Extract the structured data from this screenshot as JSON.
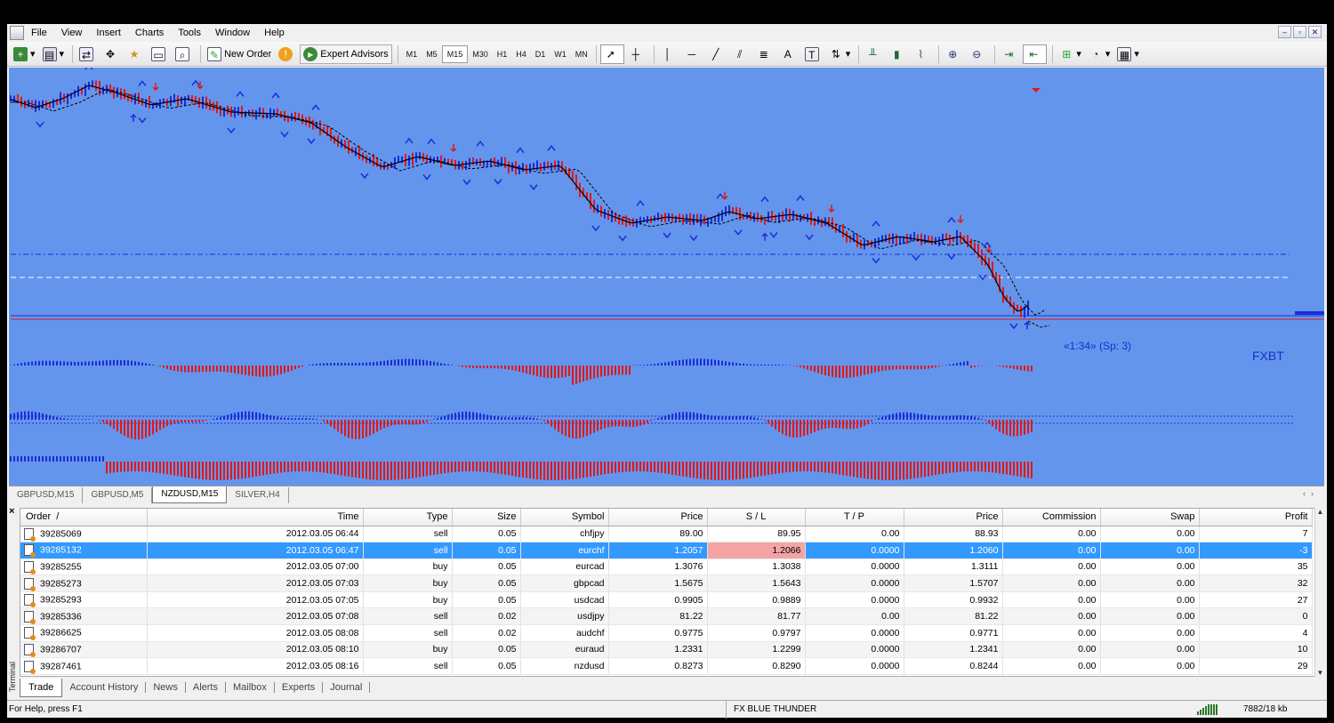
{
  "menu": [
    "File",
    "View",
    "Insert",
    "Charts",
    "Tools",
    "Window",
    "Help"
  ],
  "toolbar": {
    "new_order": "New Order",
    "expert_advisors": "Expert Advisors",
    "timeframes": [
      "M1",
      "M5",
      "M15",
      "M30",
      "H1",
      "H4",
      "D1",
      "W1",
      "MN"
    ],
    "active_timeframe": "M15"
  },
  "chart": {
    "countdown_label": "«1:34» (Sp: 3)",
    "brand": "FXBT",
    "colors": {
      "background": "#6495ed",
      "bull": "#1a2ed8",
      "bear": "#e01818",
      "ma": "#000000"
    }
  },
  "chart_tabs": [
    {
      "label": "GBPUSD,M15",
      "active": false
    },
    {
      "label": "GBPUSD,M5",
      "active": false
    },
    {
      "label": "NZDUSD,M15",
      "active": true
    },
    {
      "label": "SILVER,H4",
      "active": false
    }
  ],
  "terminal": {
    "side_label": "Terminal",
    "columns": [
      "Order",
      "Time",
      "Type",
      "Size",
      "Symbol",
      "Price",
      "S / L",
      "T / P",
      "Price",
      "Commission",
      "Swap",
      "Profit"
    ],
    "rows": [
      {
        "order": "39285069",
        "time": "2012.03.05 06:44",
        "type": "sell",
        "size": "0.05",
        "symbol": "chfjpy",
        "price": "89.00",
        "sl": "89.95",
        "tp": "0.00",
        "cur": "88.93",
        "commission": "0.00",
        "swap": "0.00",
        "profit": "7"
      },
      {
        "order": "39285132",
        "time": "2012.03.05 06:47",
        "type": "sell",
        "size": "0.05",
        "symbol": "eurchf",
        "price": "1.2057",
        "sl": "1.2066",
        "tp": "0.0000",
        "cur": "1.2060",
        "commission": "0.00",
        "swap": "0.00",
        "profit": "-3"
      },
      {
        "order": "39285255",
        "time": "2012.03.05 07:00",
        "type": "buy",
        "size": "0.05",
        "symbol": "eurcad",
        "price": "1.3076",
        "sl": "1.3038",
        "tp": "0.0000",
        "cur": "1.3111",
        "commission": "0.00",
        "swap": "0.00",
        "profit": "35"
      },
      {
        "order": "39285273",
        "time": "2012.03.05 07:03",
        "type": "buy",
        "size": "0.05",
        "symbol": "gbpcad",
        "price": "1.5675",
        "sl": "1.5643",
        "tp": "0.0000",
        "cur": "1.5707",
        "commission": "0.00",
        "swap": "0.00",
        "profit": "32"
      },
      {
        "order": "39285293",
        "time": "2012.03.05 07:05",
        "type": "buy",
        "size": "0.05",
        "symbol": "usdcad",
        "price": "0.9905",
        "sl": "0.9889",
        "tp": "0.0000",
        "cur": "0.9932",
        "commission": "0.00",
        "swap": "0.00",
        "profit": "27"
      },
      {
        "order": "39285336",
        "time": "2012.03.05 07:08",
        "type": "sell",
        "size": "0.02",
        "symbol": "usdjpy",
        "price": "81.22",
        "sl": "81.77",
        "tp": "0.00",
        "cur": "81.22",
        "commission": "0.00",
        "swap": "0.00",
        "profit": "0"
      },
      {
        "order": "39286625",
        "time": "2012.03.05 08:08",
        "type": "sell",
        "size": "0.02",
        "symbol": "audchf",
        "price": "0.9775",
        "sl": "0.9797",
        "tp": "0.0000",
        "cur": "0.9771",
        "commission": "0.00",
        "swap": "0.00",
        "profit": "4"
      },
      {
        "order": "39286707",
        "time": "2012.03.05 08:10",
        "type": "buy",
        "size": "0.05",
        "symbol": "euraud",
        "price": "1.2331",
        "sl": "1.2299",
        "tp": "0.0000",
        "cur": "1.2341",
        "commission": "0.00",
        "swap": "0.00",
        "profit": "10"
      },
      {
        "order": "39287461",
        "time": "2012.03.05 08:16",
        "type": "sell",
        "size": "0.05",
        "symbol": "nzdusd",
        "price": "0.8273",
        "sl": "0.8290",
        "tp": "0.0000",
        "cur": "0.8244",
        "commission": "0.00",
        "swap": "0.00",
        "profit": "29"
      }
    ],
    "selected_row": 1,
    "tabs": [
      "Trade",
      "Account History",
      "News",
      "Alerts",
      "Mailbox",
      "Experts",
      "Journal"
    ],
    "active_tab": "Trade"
  },
  "status": {
    "help": "For Help, press F1",
    "profile": "FX BLUE THUNDER",
    "traffic": "7882/18 kb"
  }
}
